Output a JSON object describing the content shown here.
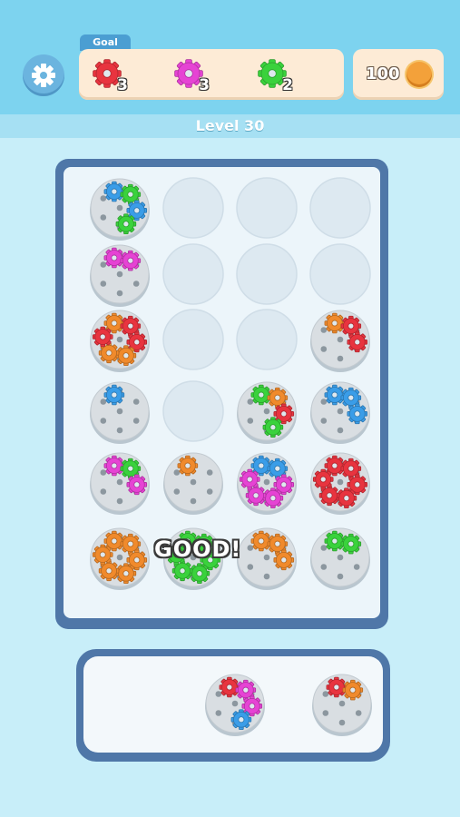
{
  "header": {
    "goal_label": "Goal",
    "goals": [
      {
        "color": "#e8343f",
        "count": "3",
        "icon": "red-gear-icon"
      },
      {
        "color": "#e643d4",
        "count": "3",
        "icon": "magenta-gear-icon"
      },
      {
        "color": "#3ad23c",
        "count": "2",
        "icon": "green-gear-icon"
      }
    ],
    "coins": "100",
    "level_label": "Level 30"
  },
  "colors": {
    "red": "#e8343f",
    "magenta": "#e643d4",
    "green": "#3ad23c",
    "blue": "#3a9de8",
    "orange": "#f08a2c",
    "board": "#4f77a8",
    "background": "#c8eef9"
  },
  "board": {
    "rows": 6,
    "cols": 4,
    "slots": [
      {
        "row": 0,
        "col": 0,
        "gears": [
          "blue",
          "green",
          "blue",
          "green"
        ]
      },
      {
        "row": 0,
        "col": 1,
        "gears": null
      },
      {
        "row": 0,
        "col": 2,
        "gears": null
      },
      {
        "row": 0,
        "col": 3,
        "gears": null
      },
      {
        "row": 1,
        "col": 0,
        "gears": [
          "magenta",
          "magenta"
        ]
      },
      {
        "row": 1,
        "col": 1,
        "gears": null
      },
      {
        "row": 1,
        "col": 2,
        "gears": null
      },
      {
        "row": 1,
        "col": 3,
        "gears": null
      },
      {
        "row": 2,
        "col": 0,
        "gears": [
          "orange",
          "red",
          "red",
          "orange",
          "orange",
          "red"
        ]
      },
      {
        "row": 2,
        "col": 1,
        "gears": null
      },
      {
        "row": 2,
        "col": 2,
        "gears": null
      },
      {
        "row": 2,
        "col": 3,
        "gears": [
          "orange",
          "red",
          "red"
        ]
      },
      {
        "row": 3,
        "col": 0,
        "gears": [
          "blue"
        ]
      },
      {
        "row": 3,
        "col": 1,
        "gears": null
      },
      {
        "row": 3,
        "col": 2,
        "gears": [
          "green",
          "orange",
          "red",
          "green"
        ]
      },
      {
        "row": 3,
        "col": 3,
        "gears": [
          "blue",
          "blue",
          "blue"
        ]
      },
      {
        "row": 4,
        "col": 0,
        "gears": [
          "magenta",
          "green",
          "magenta"
        ]
      },
      {
        "row": 4,
        "col": 1,
        "gears": [
          "orange"
        ]
      },
      {
        "row": 4,
        "col": 2,
        "gears": [
          "blue",
          "blue",
          "magenta",
          "magenta",
          "magenta",
          "magenta"
        ]
      },
      {
        "row": 4,
        "col": 3,
        "gears": [
          "red",
          "red",
          "red",
          "red",
          "red",
          "red"
        ]
      },
      {
        "row": 5,
        "col": 0,
        "gears": [
          "orange",
          "orange",
          "orange",
          "orange",
          "orange",
          "orange"
        ]
      },
      {
        "row": 5,
        "col": 1,
        "gears": [
          "green",
          "green",
          "green",
          "green",
          "green",
          "green"
        ]
      },
      {
        "row": 5,
        "col": 2,
        "gears": [
          "orange",
          "orange",
          "orange"
        ]
      },
      {
        "row": 5,
        "col": 3,
        "gears": [
          "green",
          "green"
        ]
      }
    ],
    "feedback_text": "GOOD!"
  },
  "tray": {
    "slots": [
      {
        "gears": [
          "red",
          "magenta",
          "magenta",
          "blue"
        ]
      },
      {
        "gears": [
          "red",
          "orange"
        ]
      }
    ]
  }
}
